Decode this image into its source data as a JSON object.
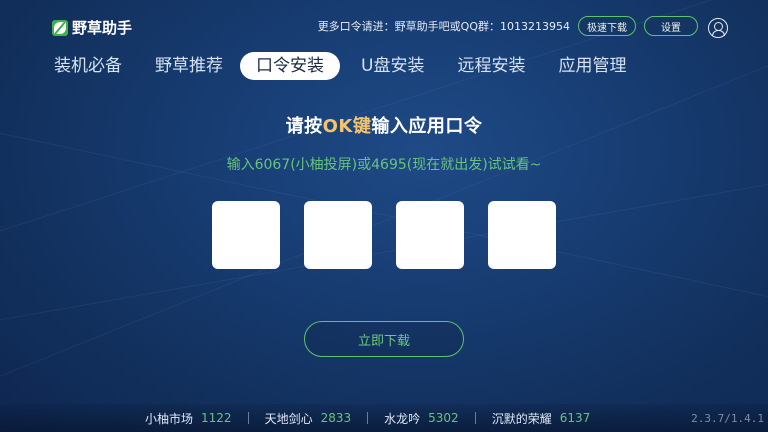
{
  "app": {
    "title": "野草助手"
  },
  "header": {
    "promo_text": "更多口令请进：野草助手吧或QQ群：1013213954",
    "fast_download_label": "极速下载",
    "settings_label": "设置",
    "user_icon": "user-icon"
  },
  "tabs": [
    {
      "label": "装机必备",
      "active": false
    },
    {
      "label": "野草推荐",
      "active": false
    },
    {
      "label": "口令安装",
      "active": true
    },
    {
      "label": "U盘安装",
      "active": false
    },
    {
      "label": "远程安装",
      "active": false
    },
    {
      "label": "应用管理",
      "active": false
    }
  ],
  "main": {
    "title_prefix": "请按",
    "title_highlight": "OK键",
    "title_suffix": "输入应用口令",
    "hint": "输入6067(小柚投屏)或4695(现在就出发)试试看~",
    "code_boxes": [
      "",
      "",
      "",
      ""
    ],
    "download_label": "立即下载"
  },
  "ticker": [
    {
      "name": "小柚市场",
      "code": "1122"
    },
    {
      "name": "天地剑心",
      "code": "2833"
    },
    {
      "name": "水龙吟",
      "code": "5302"
    },
    {
      "name": "沉默的荣耀",
      "code": "6137"
    }
  ],
  "version": "2.3.7/1.4.1",
  "colors": {
    "accent_green": "#5cc46a",
    "highlight_gold": "#f5c46a",
    "background": "#173d73"
  }
}
